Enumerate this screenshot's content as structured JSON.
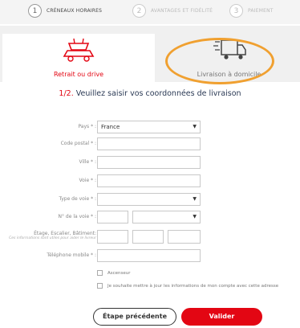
{
  "steps": [
    {
      "num": "1",
      "label": "CRÉNEAUX HORAIRES"
    },
    {
      "num": "2",
      "label": "AVANTAGES ET FIDÉLITÉ"
    },
    {
      "num": "3",
      "label": "PAIEMENT"
    }
  ],
  "tabs": {
    "pickup": {
      "label": "Retrait ou drive",
      "icon": "car-trolley-icon"
    },
    "delivery": {
      "label": "Livraison à domicile",
      "icon": "delivery-truck-icon"
    }
  },
  "colors": {
    "accent": "#e30613",
    "highlight": "#f0a030",
    "title": "#2b3a55"
  },
  "form": {
    "step_number": "1/2.",
    "title": "Veuillez saisir vos coordonnées de livraison",
    "country_label": "Pays * :",
    "country_value": "France",
    "postal_code_label": "Code postal * :",
    "city_label": "Ville * :",
    "street_label": "Voie * :",
    "street_type_label": "Type de voie * :",
    "street_number_label": "N° de la voie * :",
    "floor_label": "Étage, Escalier, Bâtiment:",
    "floor_sublabel": "Ces informations sont utiles pour aider le livreur",
    "mobile_label": "Téléphone mobile * :",
    "elevator_label": "Ascenseur",
    "update_account_label": "Je souhaite mettre à jour les informations de mon compte avec cette adresse"
  },
  "buttons": {
    "previous": "Étape précédente",
    "submit": "Valider"
  }
}
